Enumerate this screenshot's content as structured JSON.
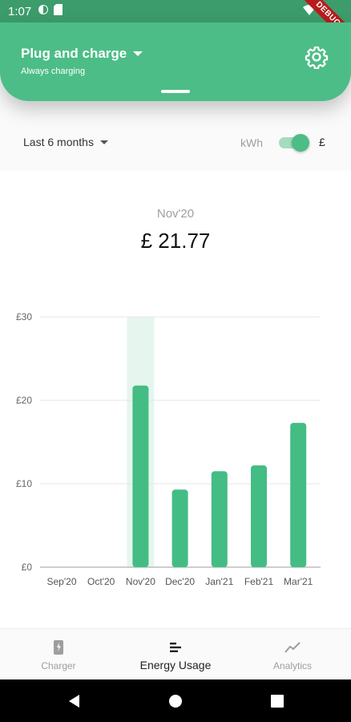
{
  "status_bar": {
    "time": "1:07",
    "debug_label": "DEBUG"
  },
  "header": {
    "title": "Plug and charge",
    "subtitle": "Always charging",
    "settings_icon": "gear-icon"
  },
  "filters": {
    "period": "Last 6 months",
    "unit_left": "kWh",
    "unit_right": "£",
    "unit_toggle_on": true
  },
  "selection": {
    "month": "Nov'20",
    "value": "£ 21.77"
  },
  "colors": {
    "brand": "#4cbd86",
    "status_bar": "#3c9c6b",
    "bar": "#43bd84",
    "highlight": "#e6f6ee"
  },
  "chart_data": {
    "type": "bar",
    "categories": [
      "Sep'20",
      "Oct'20",
      "Nov'20",
      "Dec'20",
      "Jan'21",
      "Feb'21",
      "Mar'21"
    ],
    "values": [
      0,
      0,
      21.77,
      9.3,
      11.5,
      12.2,
      17.3
    ],
    "y_ticks": [
      "£0",
      "£10",
      "£20",
      "£30"
    ],
    "y_tick_values": [
      0,
      10,
      20,
      30
    ],
    "ylim": [
      0,
      30
    ],
    "selected_index": 2,
    "grid": true
  },
  "bottom_nav": {
    "items": [
      {
        "label": "Charger",
        "icon": "charger-icon",
        "active": false
      },
      {
        "label": "Energy Usage",
        "icon": "energy-usage-icon",
        "active": true
      },
      {
        "label": "Analytics",
        "icon": "analytics-icon",
        "active": false
      }
    ]
  },
  "system_nav": {
    "back_icon": "back-icon",
    "home_icon": "home-icon",
    "recents_icon": "recents-icon"
  }
}
